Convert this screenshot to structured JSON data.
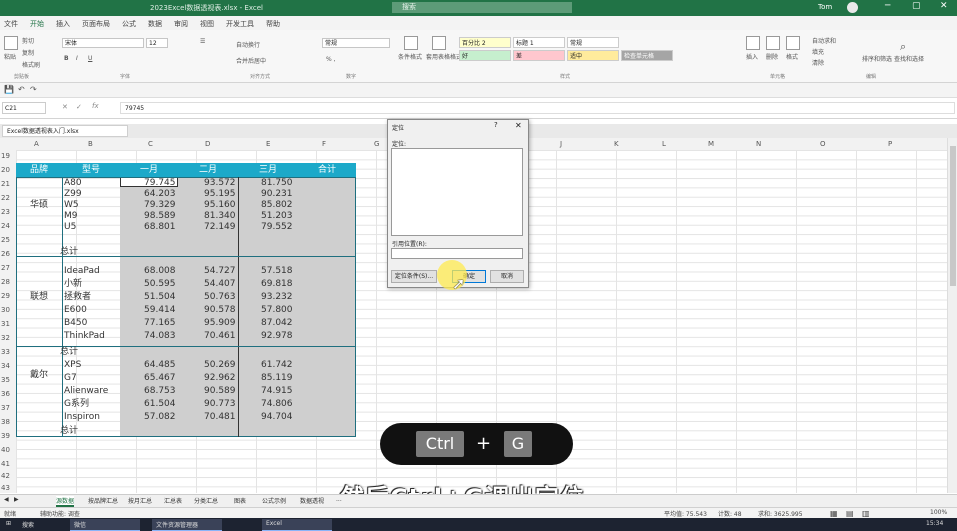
{
  "titlebar": {
    "title": "2023Excel数据透视表.xlsx - Excel",
    "search_placeholder": "搜索",
    "user": "Tom",
    "minimize": "─",
    "restore": "▢",
    "close": "✕"
  },
  "ribbon_tabs": [
    "文件",
    "开始",
    "插入",
    "页面布局",
    "公式",
    "数据",
    "审阅",
    "视图",
    "开发工具",
    "帮助"
  ],
  "ribbon": {
    "paste": "粘贴",
    "cut": "剪切",
    "copy": "复制",
    "format_painter": "格式刷",
    "font_name": "宋体",
    "font_size": "12",
    "wrap_text": "自动换行",
    "merge_center": "合并后居中",
    "number_format": "常规",
    "cond_format": "条件格式",
    "table_format": "套用表格格式",
    "styles": [
      {
        "label": "百分比 2",
        "bg": "#ffffcc"
      },
      {
        "label": "标题 1",
        "bg": "#ffffff"
      },
      {
        "label": "常规",
        "bg": "#ffffff"
      },
      {
        "label": "好",
        "bg": "#c6efce"
      },
      {
        "label": "差",
        "bg": "#ffc7ce"
      },
      {
        "label": "适中",
        "bg": "#ffeb9c"
      },
      {
        "label": "检查单元格",
        "bg": "#a5a5a5"
      }
    ],
    "insert": "插入",
    "delete": "删除",
    "format": "格式",
    "autosum": "自动求和",
    "fill": "填充",
    "clear": "清除",
    "sort_filter": "排序和筛选",
    "find_select": "查找和选择",
    "groups": [
      "剪贴板",
      "字体",
      "对齐方式",
      "数字",
      "样式",
      "单元格",
      "编辑"
    ]
  },
  "formula_bar": {
    "name_box": "C21",
    "formula": "79745"
  },
  "workbook_tab": "Excel数据透视表入门.xlsx",
  "columns": [
    "A",
    "B",
    "C",
    "D",
    "E",
    "F",
    "G",
    "H",
    "I",
    "J",
    "K",
    "L",
    "M",
    "N",
    "O",
    "P"
  ],
  "rows": [
    "19",
    "20",
    "21",
    "22",
    "23",
    "24",
    "25",
    "26",
    "27",
    "28",
    "29",
    "30",
    "31",
    "32",
    "33",
    "34",
    "35",
    "36",
    "37",
    "38",
    "39",
    "40",
    "41",
    "42",
    "43"
  ],
  "table": {
    "headers": [
      "品牌",
      "型号",
      "一月",
      "二月",
      "三月",
      "合计"
    ],
    "groups": [
      {
        "brand": "华硕",
        "models": [
          "A80",
          "Z99",
          "W5",
          "M9",
          "U5"
        ],
        "jan": [
          "79.745",
          "64.203",
          "79.329",
          "98.589",
          "68.801"
        ],
        "feb": [
          "93.572",
          "95.195",
          "95.160",
          "81.340",
          "72.149"
        ],
        "mar": [
          "81.750",
          "90.231",
          "85.802",
          "51.203",
          "79.552"
        ],
        "subtotal": "总计"
      },
      {
        "brand": "联想",
        "models": [
          "IdeaPad",
          "小新",
          "拯救者",
          "E600",
          "B450",
          "ThinkPad"
        ],
        "jan": [
          "68.008",
          "50.595",
          "51.504",
          "59.414",
          "77.165",
          "74.083"
        ],
        "feb": [
          "54.727",
          "54.407",
          "50.763",
          "90.578",
          "95.909",
          "70.461"
        ],
        "mar": [
          "57.518",
          "69.818",
          "93.232",
          "57.800",
          "87.042",
          "92.978"
        ],
        "subtotal": "总计"
      },
      {
        "brand": "戴尔",
        "models": [
          "XPS",
          "G7",
          "Alienware",
          "G系列",
          "Inspiron"
        ],
        "jan": [
          "64.485",
          "65.467",
          "68.753",
          "61.504",
          "57.082"
        ],
        "feb": [
          "50.269",
          "92.962",
          "90.589",
          "90.773",
          "70.481"
        ],
        "mar": [
          "61.742",
          "85.119",
          "74.915",
          "74.806",
          "94.704"
        ],
        "subtotal": "总计"
      }
    ]
  },
  "goto_dialog": {
    "title": "定位",
    "help": "?",
    "close": "✕",
    "goto_label": "定位:",
    "reference_label": "引用位置(R):",
    "special_button": "定位条件(S)...",
    "ok_button": "确定",
    "cancel_button": "取消"
  },
  "shortcut": {
    "key1": "Ctrl",
    "plus": "+",
    "key2": "G"
  },
  "subtitle": "然后Ctrl+G调出定位",
  "sheet_tabs": [
    "源数据",
    "按品牌汇总",
    "按月汇总",
    "汇总表",
    "分类汇总",
    "图表",
    "公式示例",
    "数据透视",
    "..."
  ],
  "status": {
    "ready": "就绪",
    "accessibility": "辅助功能: 调查",
    "average": "平均值: 75.543",
    "count": "计数: 48",
    "sum": "求和: 3625.995",
    "zoom": "100%"
  },
  "taskbar": {
    "start": "⊞",
    "search": "搜索",
    "apps": [
      "微信",
      "文件资源管理器",
      "Excel"
    ],
    "clock": "15:34"
  }
}
